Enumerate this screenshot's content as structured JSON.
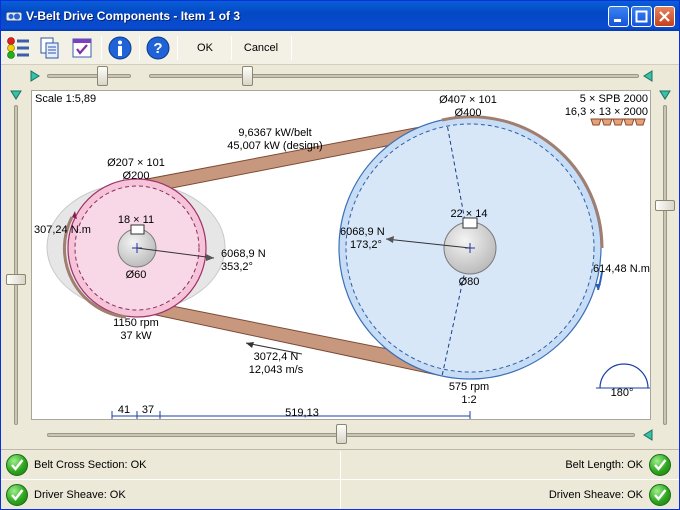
{
  "window": {
    "title": "V-Belt Drive Components - Item 1 of 3"
  },
  "toolbar": {
    "ok_label": "OK",
    "cancel_label": "Cancel",
    "icons": [
      "traffic-lights-icon",
      "copy-icon",
      "checklist-icon",
      "info-icon",
      "help-icon"
    ]
  },
  "canvas": {
    "scale": "Scale 1:5,89",
    "belt_spec": "5 × SPB 2000",
    "belt_dims": "16,3 × 13 × 2000",
    "power_per_belt": "9,6367 kW/belt",
    "power_design": "45,007 kW (design)",
    "driver": {
      "outer": "Ø207 × 101",
      "pitch": "Ø200",
      "keyway": "18 × 11",
      "bore": "Ø60",
      "torque": "307,24 N.m",
      "force": "6068,9 N",
      "force_angle": "353,2°",
      "speed": "1150 rpm",
      "power": "37 kW"
    },
    "driven": {
      "outer": "Ø407 × 101",
      "pitch": "Ø400",
      "keyway": "22 × 14",
      "bore": "Ø80",
      "torque": "614,48 N.m",
      "force": "6068,9 N",
      "force_angle": "173,2°",
      "speed": "575 rpm",
      "ratio": "1:2",
      "wrap_angle": "180°"
    },
    "belt_tension": "3072,4 N",
    "belt_speed": "12,043 m/s",
    "dim_left": "41",
    "dim_mid": "37",
    "dim_center": "519,13"
  },
  "status": {
    "belt_cross_section": "Belt Cross Section:  OK",
    "belt_length": "Belt Length:  OK",
    "driver_sheave": "Driver Sheave:  OK",
    "driven_sheave": "Driven Sheave:  OK"
  },
  "colors": {
    "title_bar": "#0348c4",
    "driver_fill": "#f4c6dc",
    "driven_fill": "#cfe3f7",
    "belt": "#c9997f",
    "status_ok": "#2fa520"
  }
}
